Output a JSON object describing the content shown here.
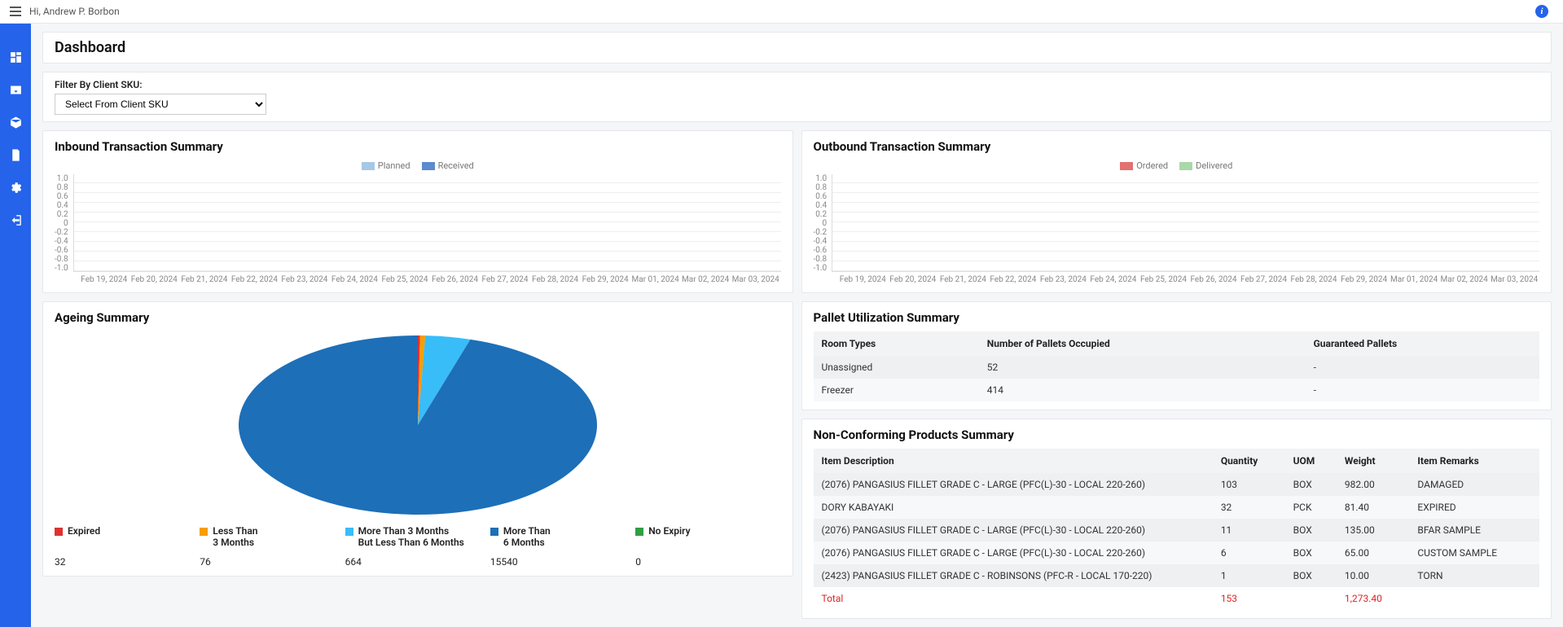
{
  "header": {
    "greeting": "Hi, Andrew P. Borbon"
  },
  "page": {
    "title": "Dashboard"
  },
  "filter": {
    "label": "Filter By Client SKU:",
    "placeholder": "Select From Client SKU"
  },
  "inbound": {
    "title": "Inbound Transaction Summary",
    "legend": {
      "planned": "Planned",
      "received": "Received"
    },
    "colors": {
      "planned": "#a7c7e7",
      "received": "#5b8bd0"
    }
  },
  "outbound": {
    "title": "Outbound Transaction Summary",
    "legend": {
      "ordered": "Ordered",
      "delivered": "Delivered"
    },
    "colors": {
      "ordered": "#e47070",
      "delivered": "#a9d8a9"
    }
  },
  "chart_shared": {
    "y_ticks": [
      "1.0",
      "0.8",
      "0.6",
      "0.4",
      "0.2",
      "0",
      "-0.2",
      "-0.4",
      "-0.6",
      "-0.8",
      "-1.0"
    ],
    "x_ticks": [
      "Feb 19, 2024",
      "Feb 20, 2024",
      "Feb 21, 2024",
      "Feb 22, 2024",
      "Feb 23, 2024",
      "Feb 24, 2024",
      "Feb 25, 2024",
      "Feb 26, 2024",
      "Feb 27, 2024",
      "Feb 28, 2024",
      "Feb 29, 2024",
      "Mar 01, 2024",
      "Mar 02, 2024",
      "Mar 03, 2024"
    ]
  },
  "ageing": {
    "title": "Ageing Summary",
    "items": [
      {
        "label_l1": "Expired",
        "label_l2": "",
        "value": "32",
        "color": "#e03131"
      },
      {
        "label_l1": "Less Than",
        "label_l2": "3 Months",
        "value": "76",
        "color": "#f59f00"
      },
      {
        "label_l1": "More Than 3 Months",
        "label_l2": "But Less Than 6 Months",
        "value": "664",
        "color": "#38bdf8"
      },
      {
        "label_l1": "More Than",
        "label_l2": "6 Months",
        "value": "15540",
        "color": "#1d6fb8"
      },
      {
        "label_l1": "No Expiry",
        "label_l2": "",
        "value": "0",
        "color": "#2f9e44"
      }
    ]
  },
  "pallet": {
    "title": "Pallet Utilization Summary",
    "headers": {
      "room": "Room Types",
      "occupied": "Number of Pallets Occupied",
      "guaranteed": "Guaranteed Pallets"
    },
    "rows": [
      {
        "room": "Unassigned",
        "occupied": "52",
        "guaranteed": "-"
      },
      {
        "room": "Freezer",
        "occupied": "414",
        "guaranteed": "-"
      }
    ]
  },
  "noncon": {
    "title": "Non-Conforming Products Summary",
    "headers": {
      "desc": "Item Description",
      "qty": "Quantity",
      "uom": "UOM",
      "weight": "Weight",
      "remarks": "Item Remarks"
    },
    "rows": [
      {
        "desc": "(2076) PANGASIUS FILLET GRADE C - LARGE (PFC(L)-30 - LOCAL 220-260)",
        "qty": "103",
        "uom": "BOX",
        "weight": "982.00",
        "remarks": "DAMAGED"
      },
      {
        "desc": "DORY KABAYAKI",
        "qty": "32",
        "uom": "PCK",
        "weight": "81.40",
        "remarks": "EXPIRED"
      },
      {
        "desc": "(2076) PANGASIUS FILLET GRADE C - LARGE (PFC(L)-30 - LOCAL 220-260)",
        "qty": "11",
        "uom": "BOX",
        "weight": "135.00",
        "remarks": "BFAR SAMPLE"
      },
      {
        "desc": "(2076) PANGASIUS FILLET GRADE C - LARGE (PFC(L)-30 - LOCAL 220-260)",
        "qty": "6",
        "uom": "BOX",
        "weight": "65.00",
        "remarks": "CUSTOM SAMPLE"
      },
      {
        "desc": "(2423) PANGASIUS FILLET GRADE C - ROBINSONS (PFC-R - LOCAL 170-220)",
        "qty": "1",
        "uom": "BOX",
        "weight": "10.00",
        "remarks": "TORN"
      }
    ],
    "total": {
      "label": "Total",
      "qty": "153",
      "uom": "",
      "weight": "1,273.40",
      "remarks": ""
    }
  },
  "chart_data": [
    {
      "type": "bar",
      "title": "Inbound Transaction Summary",
      "ylim": [
        -1.0,
        1.0
      ],
      "categories": [
        "Feb 19, 2024",
        "Feb 20, 2024",
        "Feb 21, 2024",
        "Feb 22, 2024",
        "Feb 23, 2024",
        "Feb 24, 2024",
        "Feb 25, 2024",
        "Feb 26, 2024",
        "Feb 27, 2024",
        "Feb 28, 2024",
        "Feb 29, 2024",
        "Mar 01, 2024",
        "Mar 02, 2024",
        "Mar 03, 2024"
      ],
      "series": [
        {
          "name": "Planned",
          "values": [
            0,
            0,
            0,
            0,
            0,
            0,
            0,
            0,
            0,
            0,
            0,
            0,
            0,
            0
          ]
        },
        {
          "name": "Received",
          "values": [
            0,
            0,
            0,
            0,
            0,
            0,
            0,
            0,
            0,
            0,
            0,
            0,
            0,
            0
          ]
        }
      ]
    },
    {
      "type": "bar",
      "title": "Outbound Transaction Summary",
      "ylim": [
        -1.0,
        1.0
      ],
      "categories": [
        "Feb 19, 2024",
        "Feb 20, 2024",
        "Feb 21, 2024",
        "Feb 22, 2024",
        "Feb 23, 2024",
        "Feb 24, 2024",
        "Feb 25, 2024",
        "Feb 26, 2024",
        "Feb 27, 2024",
        "Feb 28, 2024",
        "Feb 29, 2024",
        "Mar 01, 2024",
        "Mar 02, 2024",
        "Mar 03, 2024"
      ],
      "series": [
        {
          "name": "Ordered",
          "values": [
            0,
            0,
            0,
            0,
            0,
            0,
            0,
            0,
            0,
            0,
            0,
            0,
            0,
            0
          ]
        },
        {
          "name": "Delivered",
          "values": [
            0,
            0,
            0,
            0,
            0,
            0,
            0,
            0,
            0,
            0,
            0,
            0,
            0,
            0
          ]
        }
      ]
    },
    {
      "type": "pie",
      "title": "Ageing Summary",
      "series": [
        {
          "name": "Expired",
          "value": 32
        },
        {
          "name": "Less Than 3 Months",
          "value": 76
        },
        {
          "name": "More Than 3 Months But Less Than 6 Months",
          "value": 664
        },
        {
          "name": "More Than 6 Months",
          "value": 15540
        },
        {
          "name": "No Expiry",
          "value": 0
        }
      ]
    }
  ]
}
